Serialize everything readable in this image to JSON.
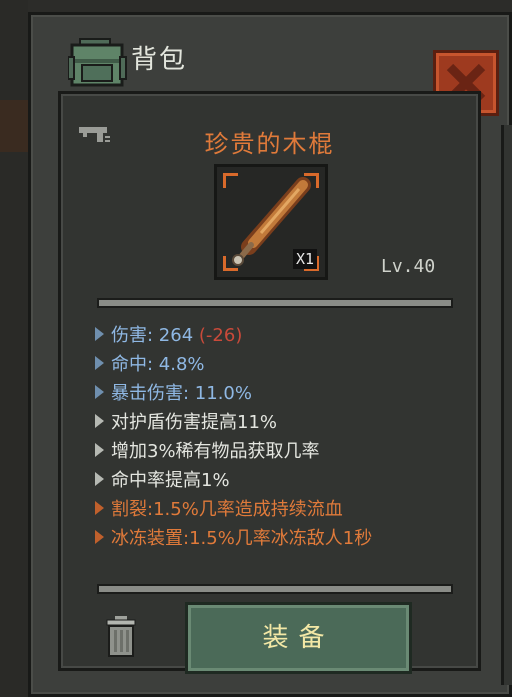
{
  "window": {
    "title": "背包",
    "title_icon": "backpack-icon",
    "close_icon": "close-icon"
  },
  "item": {
    "name": "珍贵的木棍",
    "category_icon": "gun-icon",
    "image_icon": "baseball-bat-icon",
    "quantity": "X1",
    "level": "Lv.40"
  },
  "stats": [
    {
      "prefix": "伤害: ",
      "value": "264",
      "delta": "(-26)",
      "color": "blue"
    },
    {
      "prefix": "命中: ",
      "value": "4.8%",
      "color": "blue"
    },
    {
      "prefix": "暴击伤害: ",
      "value": "11.0%",
      "color": "blue"
    },
    {
      "text": "对护盾伤害提高11%",
      "color": "white"
    },
    {
      "text": "增加3%稀有物品获取几率",
      "color": "white"
    },
    {
      "text": "命中率提高1%",
      "color": "white"
    },
    {
      "text": "割裂:1.5%几率造成持续流血",
      "color": "orange"
    },
    {
      "text": "冰冻装置:1.5%几率冰冻敌人1秒",
      "color": "orange"
    }
  ],
  "actions": {
    "equip_label": "装备",
    "trash_icon": "trash-icon"
  },
  "colors": {
    "accent_orange": "#e07a3a",
    "stat_blue": "#8fb8e4",
    "negative_red": "#c94a3a",
    "equip_green": "#4b6a58",
    "close_red": "#9e3a1f"
  }
}
